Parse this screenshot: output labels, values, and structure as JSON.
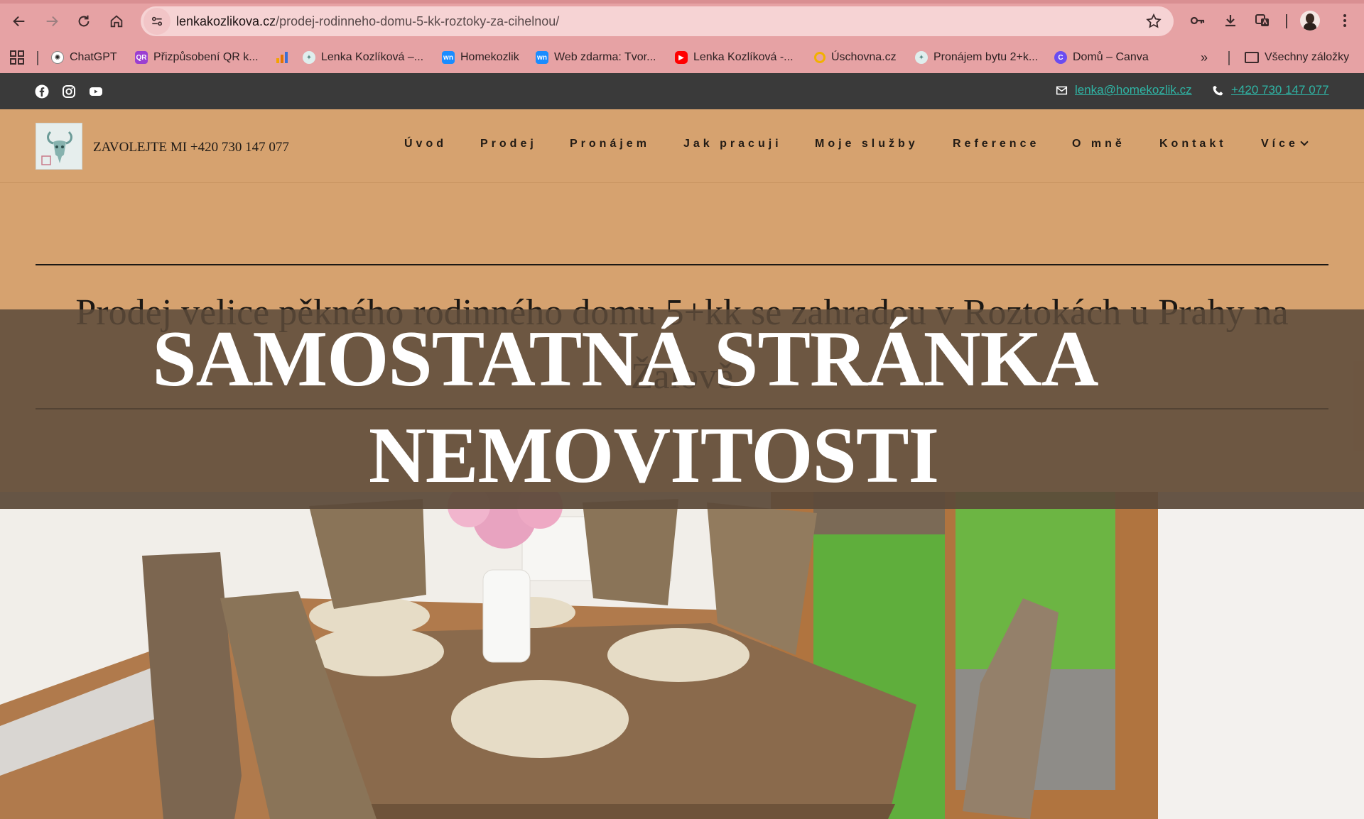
{
  "browser": {
    "url_host": "lenkakozlikova.cz",
    "url_path": "/prodej-rodinneho-domu-5-kk-roztoky-za-cihelnou/",
    "bookmarks": [
      {
        "label": "ChatGPT",
        "icon": "chatgpt-icon",
        "color": "#ffffff"
      },
      {
        "label": "Přizpůsobení QR k...",
        "icon": "qr-icon",
        "color": "#9b3fd1"
      },
      {
        "label": "",
        "icon": "analytics-icon",
        "color": "#f4a300"
      },
      {
        "label": "Lenka Kozlíková –...",
        "icon": "goat-logo-icon",
        "color": "#9fc3c0"
      },
      {
        "label": "Homekozlik",
        "icon": "webnode-icon",
        "color": "#1a8cff"
      },
      {
        "label": "Web zdarma: Tvor...",
        "icon": "webnode-icon",
        "color": "#1a8cff"
      },
      {
        "label": "Lenka Kozlíková -...",
        "icon": "youtube-icon",
        "color": "#ff0000"
      },
      {
        "label": "Úschovna.cz",
        "icon": "uschovna-icon",
        "color": "#f2b100"
      },
      {
        "label": "Pronájem bytu 2+k...",
        "icon": "goat-logo-icon",
        "color": "#9fc3c0"
      },
      {
        "label": "Domů – Canva",
        "icon": "canva-icon",
        "color": "#6a4cf0"
      }
    ],
    "all_bookmarks": "Všechny záložky"
  },
  "topbar": {
    "email": "lenka@homekozlik.cz",
    "phone": "+420 730 147 077"
  },
  "header": {
    "logo_text": "ZAVOLEJTE MI +420 730 147 077",
    "nav": [
      "Úvod",
      "Prodej",
      "Pronájem",
      "Jak pracuji",
      "Moje služby",
      "Reference",
      "O mně",
      "Kontakt",
      "Více"
    ]
  },
  "hero": {
    "title": "Prodej velice pěkného rodinného domu 5+kk se zahradou v Roztokách u Prahy na Žalově",
    "banner_line1": "SAMOSTATNÁ STRÁNKA",
    "banner_line2": "NEMOVITOSTI"
  },
  "colors": {
    "chrome": "#e6a2a4",
    "topbar": "#3a3a3a",
    "header": "#d6a26f",
    "link": "#2fb5a5",
    "overlay": "#5c4a3a"
  }
}
